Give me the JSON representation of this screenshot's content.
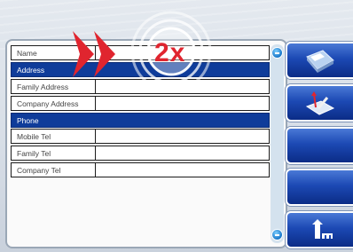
{
  "form": {
    "rows": [
      {
        "type": "field",
        "label": "Name"
      },
      {
        "type": "section",
        "label": "Address"
      },
      {
        "type": "field",
        "label": "Family Address"
      },
      {
        "type": "field",
        "label": "Company Address"
      },
      {
        "type": "section",
        "label": "Phone"
      },
      {
        "type": "field",
        "label": "Mobile Tel"
      },
      {
        "type": "field",
        "label": "Family Tel"
      },
      {
        "type": "field",
        "label": "Company Tel"
      }
    ]
  },
  "overlay": {
    "speed_label": "2x"
  },
  "sidebar": {
    "buttons": [
      {
        "icon": "save-icon"
      },
      {
        "icon": "edit-icon"
      },
      {
        "icon": ""
      },
      {
        "icon": ""
      },
      {
        "icon": "home-icon"
      }
    ]
  },
  "colors": {
    "section": "#0f3c9a",
    "button": "#1c49b4",
    "accent": "#e0252f"
  }
}
